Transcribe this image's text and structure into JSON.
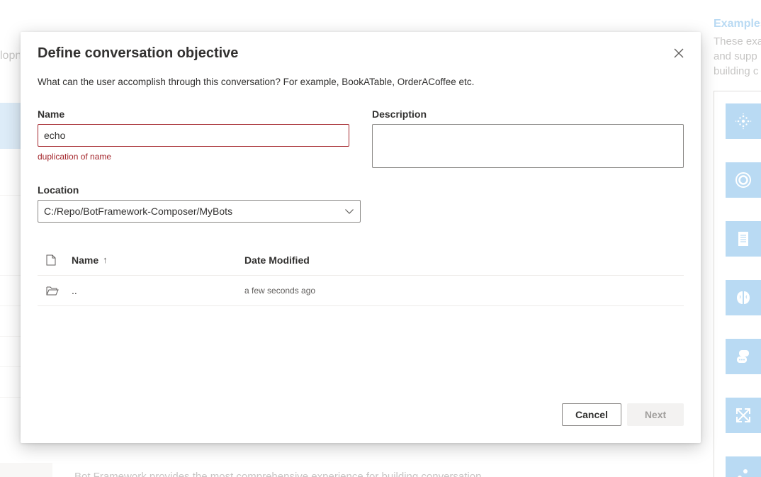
{
  "background": {
    "left_partial_text": "lopn",
    "bottom_partial_text": "Bot Framework provides the most comprehensive experience for building conversation",
    "examples": {
      "title": "Examples",
      "description_lines": [
        "These exa",
        "and supp",
        "building c"
      ]
    },
    "tile_icons": [
      "sparkle-icon",
      "ring-icon",
      "document-icon",
      "brain-icon",
      "chat-bubbles-icon",
      "expand-arrows-icon",
      "dots-icon"
    ]
  },
  "dialog": {
    "title": "Define conversation objective",
    "subtitle": "What can the user accomplish through this conversation? For example, BookATable, OrderACoffee etc.",
    "name": {
      "label": "Name",
      "value": "echo",
      "error": "duplication of name"
    },
    "description": {
      "label": "Description",
      "value": ""
    },
    "location": {
      "label": "Location",
      "value": "C:/Repo/BotFramework-Composer/MyBots"
    },
    "file_table": {
      "columns": {
        "name": "Name",
        "sort_indicator": "↑",
        "date": "Date Modified"
      },
      "rows": [
        {
          "name": "..",
          "date": "a few seconds ago"
        }
      ]
    },
    "buttons": {
      "cancel": "Cancel",
      "next": "Next"
    }
  },
  "colors": {
    "accent": "#0078d4",
    "error": "#a4262c",
    "tile_bg": "#8ac1eb"
  }
}
